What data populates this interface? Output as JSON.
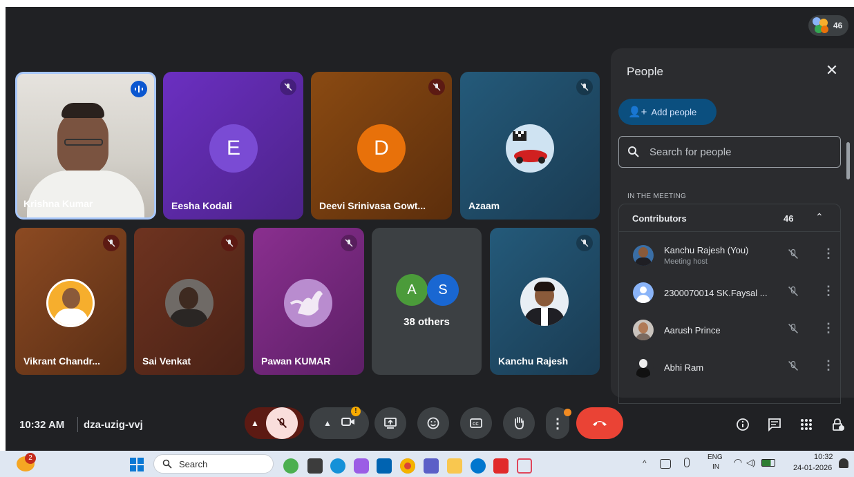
{
  "top_badge": {
    "count": "46"
  },
  "tiles": [
    {
      "name": "Krishna Kumar"
    },
    {
      "name": "Eesha Kodali",
      "initial": "E"
    },
    {
      "name": "Deevi Srinivasa Gowt...",
      "initial": "D"
    },
    {
      "name": "Azaam"
    },
    {
      "name": "Vikrant Chandr..."
    },
    {
      "name": "Sai Venkat"
    },
    {
      "name": "Pawan KUMAR"
    },
    {
      "name": "38 others",
      "initials": [
        "A",
        "S"
      ]
    },
    {
      "name": "Kanchu Rajesh"
    }
  ],
  "people_panel": {
    "title": "People",
    "add_people": "Add people",
    "search_placeholder": "Search for people",
    "section": "IN THE MEETING",
    "group": {
      "label": "Contributors",
      "count": "46"
    },
    "people": [
      {
        "name": "Kanchu Rajesh (You)",
        "sub": "Meeting host"
      },
      {
        "name": "2300070014 SK.Faysal ..."
      },
      {
        "name": "Aarush Prince"
      },
      {
        "name": "Abhi Ram"
      }
    ]
  },
  "meeting": {
    "time": "10:32 AM",
    "code": "dza-uzig-vvj"
  },
  "taskbar": {
    "notification_count": "2",
    "search": "Search",
    "lang_top": "ENG",
    "lang_bottom": "IN",
    "clock_time": "10:32",
    "clock_date": "24-01-2026"
  },
  "colors": {
    "bg": "#202124",
    "accent_blue": "#0b57d0",
    "end_call_red": "#ea4335",
    "muted_red": "#5c1a13"
  }
}
